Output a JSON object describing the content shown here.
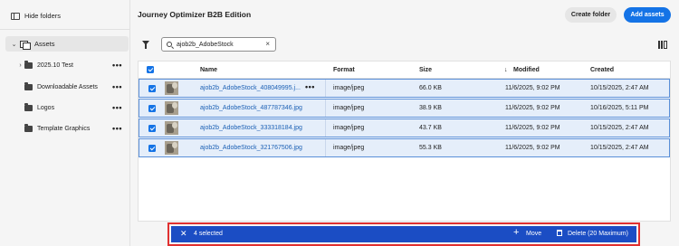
{
  "sidebar": {
    "hide_folders_label": "Hide folders",
    "root_label": "Assets",
    "folders": [
      {
        "label": "2025.10 Test"
      },
      {
        "label": "Downloadable Assets"
      },
      {
        "label": "Logos"
      },
      {
        "label": "Template Graphics"
      }
    ],
    "more_glyph": "•••"
  },
  "header": {
    "title": "Journey Optimizer B2B Edition",
    "create_folder_label": "Create folder",
    "add_assets_label": "Add assets"
  },
  "toolbar": {
    "search_value": "ajob2b_AdobeStock",
    "clear_glyph": "×"
  },
  "table": {
    "columns": {
      "name": "Name",
      "format": "Format",
      "size": "Size",
      "modified": "Modified",
      "created": "Created",
      "sort_glyph": "↓"
    },
    "rows": [
      {
        "name": "ajob2b_AdobeStock_408049995.j...",
        "format": "image/jpeg",
        "size": "66.0 KB",
        "modified": "11/6/2025, 9:02 PM",
        "created": "10/15/2025, 2:47 AM"
      },
      {
        "name": "ajob2b_AdobeStock_487787346.jpg",
        "format": "image/jpeg",
        "size": "38.9 KB",
        "modified": "11/6/2025, 9:02 PM",
        "created": "10/16/2025, 5:11 PM"
      },
      {
        "name": "ajob2b_AdobeStock_333318184.jpg",
        "format": "image/jpeg",
        "size": "43.7 KB",
        "modified": "11/6/2025, 9:02 PM",
        "created": "10/15/2025, 2:47 AM"
      },
      {
        "name": "ajob2b_AdobeStock_321767506.jpg",
        "format": "image/jpeg",
        "size": "55.3 KB",
        "modified": "11/6/2025, 9:02 PM",
        "created": "10/15/2025, 2:47 AM"
      }
    ],
    "row_more_glyph": "•••"
  },
  "action_bar": {
    "close_glyph": "✕",
    "selected_label": "4 selected",
    "move_glyph": "+",
    "move_label": "Move",
    "delete_label": "Delete (20 Maximum)"
  },
  "colors": {
    "accent": "#1473e6",
    "action_bar": "#1b4dc4",
    "selected_row": "#e5eefa",
    "highlight_border": "#e03030"
  }
}
